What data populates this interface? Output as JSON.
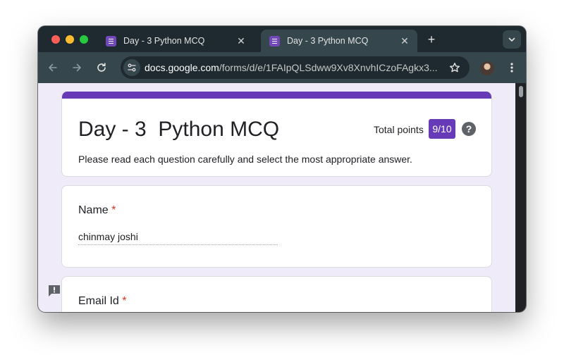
{
  "browser": {
    "tabs": [
      {
        "title": "Day - 3 Python MCQ",
        "active": false
      },
      {
        "title": "Day - 3 Python MCQ",
        "active": true
      }
    ],
    "url_host": "docs.google.com",
    "url_path": "/forms/d/e/1FAIpQLSdww9Xv8XnvhICzoFAgkx3..."
  },
  "form": {
    "title": "Day - 3  Python MCQ",
    "total_points_label": "Total points",
    "score": "9/10",
    "help": "?",
    "description": "Please read each question carefully and select the most appropriate answer.",
    "questions": [
      {
        "label": "Name",
        "required_mark": "*",
        "answer": "chinmay joshi"
      },
      {
        "label": "Email Id",
        "required_mark": "*"
      }
    ]
  },
  "colors": {
    "accent": "#673ab7",
    "background": "#f0ebf8",
    "required": "#d93025"
  }
}
